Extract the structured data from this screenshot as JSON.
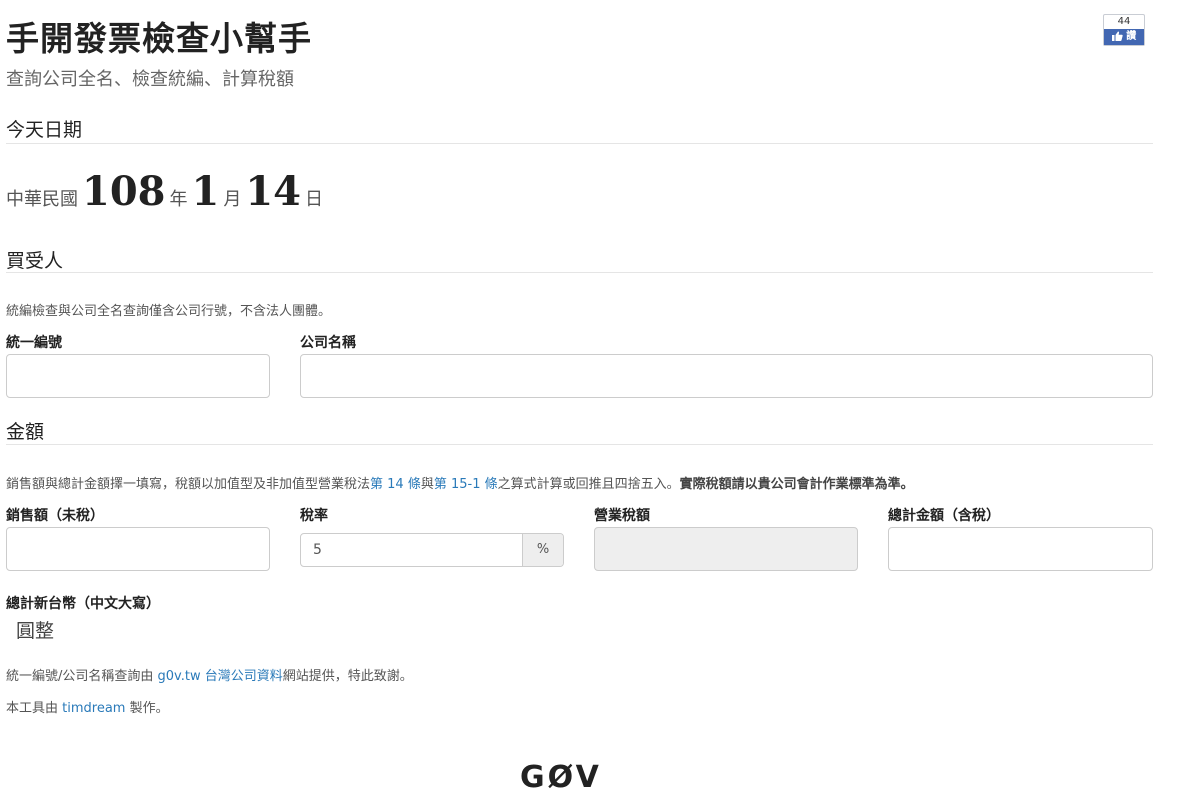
{
  "header": {
    "title": "手開發票檢查小幫手",
    "subtitle": "查詢公司全名、檢查統編、計算稅額",
    "like": {
      "count": "44",
      "label": "讚",
      "icon": "thumbs-up-icon"
    }
  },
  "today": {
    "heading": "今天日期",
    "era": "中華民國",
    "year": "108",
    "year_unit": "年",
    "month": "1",
    "month_unit": "月",
    "day": "14",
    "day_unit": "日"
  },
  "buyer": {
    "heading": "買受人",
    "note": "統編檢查與公司全名查詢僅含公司行號，不含法人團體。",
    "tax_id_label": "統一編號",
    "tax_id_value": "",
    "company_label": "公司名稱",
    "company_value": ""
  },
  "amount": {
    "heading": "金額",
    "note_prefix": "銷售額與總計金額擇一填寫，稅額以加值型及非加值型營業稅法",
    "law_link_1": "第 14 條",
    "note_and": "與",
    "law_link_2": "第 15-1 條",
    "note_suffix": "之算式計算或回推且四捨五入。",
    "note_bold": "實際稅額請以貴公司會計作業標準為準。",
    "sales_label": "銷售額（未稅）",
    "sales_value": "",
    "rate_label": "稅率",
    "rate_value": "5",
    "rate_unit": "%",
    "tax_label": "營業稅額",
    "tax_value": "",
    "total_label": "總計金額（含稅）",
    "total_value": "",
    "words_label": "總計新台幣（中文大寫）",
    "words_value": "圓整"
  },
  "footer": {
    "credit_prefix": "統一編號/公司名稱查詢由 ",
    "credit_link": "g0v.tw 台灣公司資料",
    "credit_suffix": "網站提供，特此致謝。",
    "author_prefix": "本工具由 ",
    "author_link": "timdream",
    "author_suffix": " 製作。",
    "logo": "GØV"
  },
  "colors": {
    "link": "#2a7ab9",
    "fb_blue": "#4267b2",
    "disabled_bg": "#eeeeee"
  }
}
